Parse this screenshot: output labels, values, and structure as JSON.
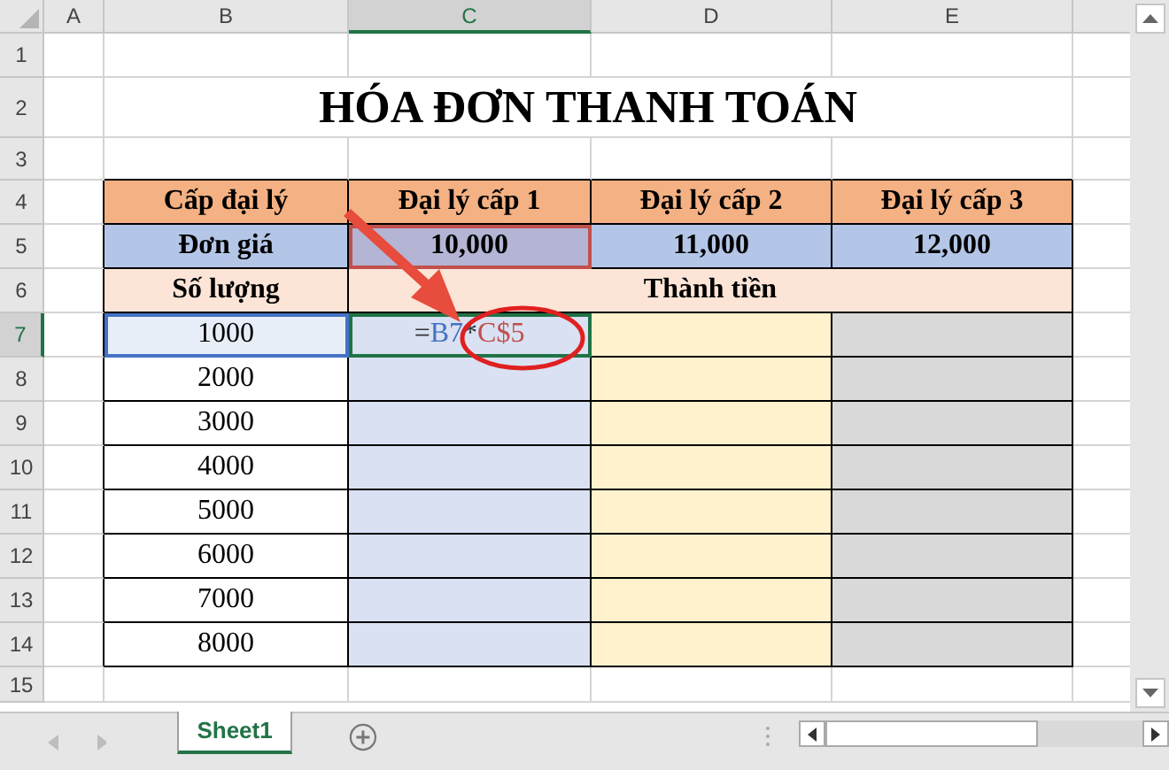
{
  "columns": [
    {
      "label": "A",
      "selected": false
    },
    {
      "label": "B",
      "selected": false
    },
    {
      "label": "C",
      "selected": true
    },
    {
      "label": "D",
      "selected": false
    },
    {
      "label": "E",
      "selected": false
    }
  ],
  "row_headers": [
    {
      "label": "1",
      "selected": false
    },
    {
      "label": "2",
      "selected": false
    },
    {
      "label": "3",
      "selected": false
    },
    {
      "label": "4",
      "selected": false
    },
    {
      "label": "5",
      "selected": false
    },
    {
      "label": "6",
      "selected": false
    },
    {
      "label": "7",
      "selected": true
    },
    {
      "label": "8",
      "selected": false
    },
    {
      "label": "9",
      "selected": false
    },
    {
      "label": "10",
      "selected": false
    },
    {
      "label": "11",
      "selected": false
    },
    {
      "label": "12",
      "selected": false
    },
    {
      "label": "13",
      "selected": false
    },
    {
      "label": "14",
      "selected": false
    },
    {
      "label": "15",
      "selected": false
    }
  ],
  "title": "HÓA ĐƠN THANH TOÁN",
  "header_row": [
    "Cấp đại lý",
    "Đại lý cấp 1",
    "Đại lý cấp 2",
    "Đại lý cấp 3"
  ],
  "price_row": {
    "label": "Đơn giá",
    "values": [
      "10,000",
      "11,000",
      "12,000"
    ]
  },
  "quantity_header": "Số lượng",
  "amount_header": "Thành tiền",
  "quantities": [
    "1000",
    "2000",
    "3000",
    "4000",
    "5000",
    "6000",
    "7000",
    "8000"
  ],
  "formula": [
    {
      "text": "=",
      "color": "#333333"
    },
    {
      "text": "B7",
      "color": "#4472c4"
    },
    {
      "text": "*",
      "color": "#333333"
    },
    {
      "text": "C$5",
      "color": "#c0504d"
    }
  ],
  "sheet_tabs": [
    {
      "label": "Sheet1",
      "selected": true
    }
  ]
}
